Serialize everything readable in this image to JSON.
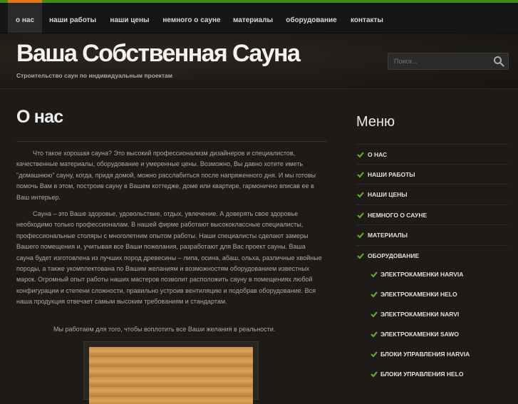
{
  "nav": [
    {
      "label": "о нас"
    },
    {
      "label": "наши работы"
    },
    {
      "label": "наши цены"
    },
    {
      "label": "немного о сауне"
    },
    {
      "label": "материалы"
    },
    {
      "label": "оборудование"
    },
    {
      "label": "контакты"
    }
  ],
  "site": {
    "title": "Ваша Собственная Сауна",
    "description": "Строительство саун по индивидуальным проектам"
  },
  "search": {
    "placeholder": "Поиск..."
  },
  "page": {
    "title": "О нас",
    "paragraphs": [
      "Что такое хорошая сауна? Это высокий профессионализм дизайнеров и специалистов, качественные материалы, оборудование и умеренные цены. Возможно, Вы давно хотите иметь \"домашнюю\" сауну, когда, придя домой, можно расслабиться после напряженного дня. И мы готовы помочь Вам в этом, построив сауну в Вашем коттедже, доме или квартире, гармонично вписав ее в Ваш интерьер.",
      "Сауна – это Ваше здоровье, удовольствие, отдых, увлечение. А доверять свое здоровье необходимо только профессионалам. В нашей фирме работают высококлассные специалисты, профессиональные столяры с многолетним опытом работы. Наши специалисты сделают замеры Вашего помещения и, учитывая все Ваши пожелания, разработают для Вас проект сауны. Ваша сауна будет изготовлена из лучших пород древесины – липа, осина, абаш, ольха, различные хвойные породы, а также укомплектована по Вашим желаниям и возможностям оборудованием известных марок. Огромный опыт работы наших мастеров позволит расположить сауну в помещениях любой конфигурации и степени сложности, правильно устроив вентиляцию и подобрав оборудование. Вся наша продукция отвечает самым высоким требованиям и стандартам.",
      "Мы работаем для того, чтобы воплотить все Ваши желания в реальности."
    ]
  },
  "sidebar": {
    "title": "Меню",
    "items": [
      {
        "label": "О НАС"
      },
      {
        "label": "НАШИ РАБОТЫ"
      },
      {
        "label": "НАШИ ЦЕНЫ"
      },
      {
        "label": "НЕМНОГО О САУНЕ"
      },
      {
        "label": "МАТЕРИАЛЫ"
      },
      {
        "label": "ОБОРУДОВАНИЕ"
      }
    ],
    "subitems": [
      {
        "label": "ЭЛЕКТРОКАМЕНКИ HARVIA"
      },
      {
        "label": "ЭЛЕКТРОКАМЕНКИ HELO"
      },
      {
        "label": "ЭЛЕКТРОКАМЕНКИ NARVI"
      },
      {
        "label": "ЭЛЕКТРОКАМЕНКИ SAWO"
      },
      {
        "label": "БЛОКИ УПРАВЛЕНИЯ HARVIA"
      },
      {
        "label": "БЛОКИ УПРАВЛЕНИЯ HELO"
      }
    ]
  },
  "colors": {
    "accent": "#3f8a1f",
    "active_tab": "#e0771c",
    "check": "#5ea82d"
  }
}
